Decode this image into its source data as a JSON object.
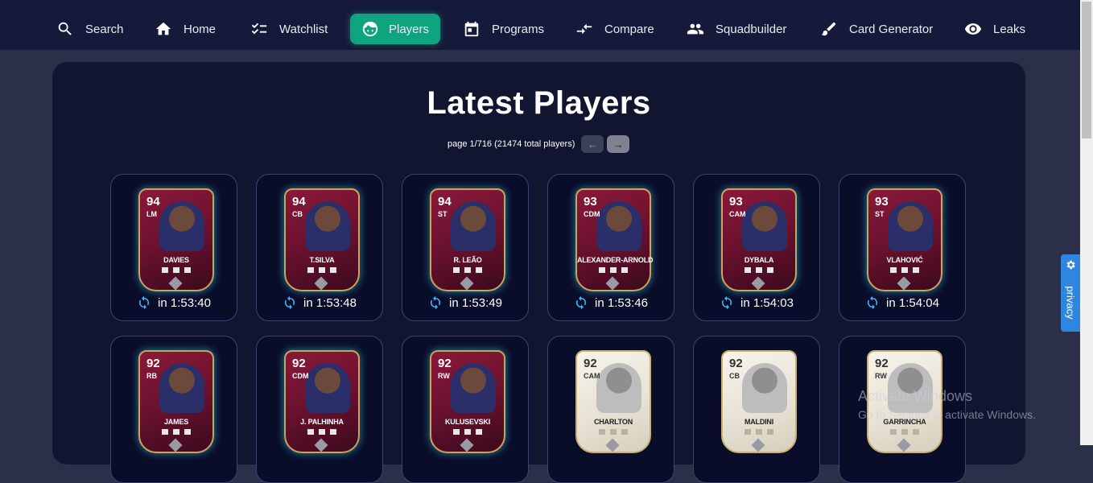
{
  "nav": {
    "items": [
      {
        "label": "Search",
        "icon": "search-icon"
      },
      {
        "label": "Home",
        "icon": "home-icon"
      },
      {
        "label": "Watchlist",
        "icon": "checklist-icon"
      },
      {
        "label": "Players",
        "icon": "face-icon",
        "active": true
      },
      {
        "label": "Programs",
        "icon": "calendar-icon"
      },
      {
        "label": "Compare",
        "icon": "compare-arrows-icon"
      },
      {
        "label": "Squadbuilder",
        "icon": "people-icon"
      },
      {
        "label": "Card Generator",
        "icon": "brush-icon"
      },
      {
        "label": "Leaks",
        "icon": "eye-icon"
      }
    ],
    "active_color": "#0fa37f"
  },
  "main": {
    "title": "Latest Players",
    "pagination": {
      "text": "page 1/716 (21474 total players)",
      "prev": "←",
      "next": "→"
    }
  },
  "players": [
    {
      "rating": "94",
      "position": "LM",
      "name": "DAVIES",
      "timer": "in 1:53:40",
      "style": "tots"
    },
    {
      "rating": "94",
      "position": "CB",
      "name": "T.SILVA",
      "timer": "in 1:53:48",
      "style": "tots"
    },
    {
      "rating": "94",
      "position": "ST",
      "name": "R. LEÃO",
      "timer": "in 1:53:49",
      "style": "tots"
    },
    {
      "rating": "93",
      "position": "CDM",
      "name": "ALEXANDER-ARNOLD",
      "timer": "in 1:53:46",
      "style": "tots"
    },
    {
      "rating": "93",
      "position": "CAM",
      "name": "DYBALA",
      "timer": "in 1:54:03",
      "style": "tots"
    },
    {
      "rating": "93",
      "position": "ST",
      "name": "VLAHOVIĆ",
      "timer": "in 1:54:04",
      "style": "tots"
    },
    {
      "rating": "92",
      "position": "RB",
      "name": "JAMES",
      "style": "tots"
    },
    {
      "rating": "92",
      "position": "CDM",
      "name": "J. PALHINHA",
      "style": "tots"
    },
    {
      "rating": "92",
      "position": "RW",
      "name": "KULUSEVSKI",
      "style": "tots"
    },
    {
      "rating": "92",
      "position": "CAM",
      "name": "CHARLTON",
      "style": "icon"
    },
    {
      "rating": "92",
      "position": "CB",
      "name": "MALDINI",
      "style": "icon"
    },
    {
      "rating": "92",
      "position": "RW",
      "name": "GARRINCHA",
      "style": "icon"
    }
  ],
  "watermark": {
    "title": "Activate Windows",
    "subtitle": "Go to Settings to activate Windows."
  },
  "privacy": {
    "label": "privacy",
    "icon": "gear-icon",
    "color": "#2e86de"
  },
  "timer_icon": "sync-icon"
}
